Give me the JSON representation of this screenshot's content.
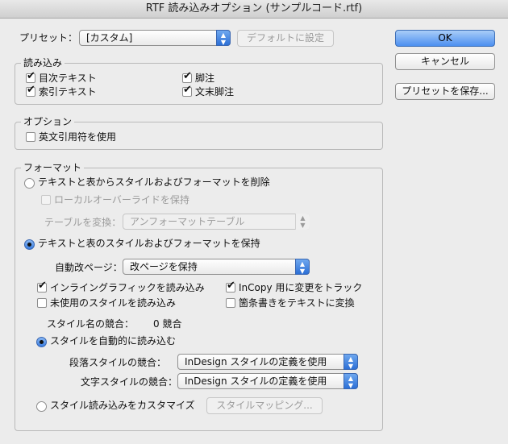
{
  "window": {
    "title": "RTF 読み込みオプション (サンプルコード.rtf)"
  },
  "preset": {
    "label": "プリセット：",
    "value": "[カスタム]",
    "default_button": "デフォルトに設定"
  },
  "buttons": {
    "ok": "OK",
    "cancel": "キャンセル",
    "save_preset": "プリセットを保存..."
  },
  "import_group": {
    "title": "読み込み",
    "items": [
      {
        "label": "目次テキスト",
        "checked": true
      },
      {
        "label": "脚注",
        "checked": true
      },
      {
        "label": "索引テキスト",
        "checked": true
      },
      {
        "label": "文末脚注",
        "checked": true
      }
    ]
  },
  "options_group": {
    "title": "オプション",
    "use_typographer_quotes": {
      "label": "英文引用符を使用",
      "checked": false
    }
  },
  "format_group": {
    "title": "フォーマット",
    "remove_styles_radio": {
      "label": "テキストと表からスタイルおよびフォーマットを削除",
      "selected": false
    },
    "keep_local_overrides": {
      "label": "ローカルオーバーライドを保持",
      "checked": false,
      "enabled": false
    },
    "convert_tables": {
      "label": "テーブルを変換：",
      "value": "アンフォーマットテーブル",
      "enabled": false
    },
    "keep_styles_radio": {
      "label": "テキストと表のスタイルおよびフォーマットを保持",
      "selected": true
    },
    "page_break": {
      "label": "自動改ページ：",
      "value": "改ページを保持"
    },
    "import_inline_graphics": {
      "label": "インライングラフィックを読み込み",
      "checked": true
    },
    "track_incopy_changes": {
      "label": "InCopy 用に変更をトラック",
      "checked": true
    },
    "import_unused_styles": {
      "label": "未使用のスタイルを読み込み",
      "checked": false
    },
    "convert_bullets": {
      "label": "箇条書きをテキストに変換",
      "checked": false
    },
    "style_conflicts": {
      "label": "スタイル名の競合：",
      "value": "0 競合"
    },
    "auto_import_radio": {
      "label": "スタイルを自動的に読み込む",
      "selected": true
    },
    "paragraph_style_conflicts": {
      "label": "段落スタイルの競合：",
      "value": "InDesign スタイルの定義を使用"
    },
    "character_style_conflicts": {
      "label": "文字スタイルの競合：",
      "value": "InDesign スタイルの定義を使用"
    },
    "customize_radio": {
      "label": "スタイル読み込みをカスタマイズ",
      "selected": false
    },
    "style_mapping_button": "スタイルマッピング..."
  }
}
